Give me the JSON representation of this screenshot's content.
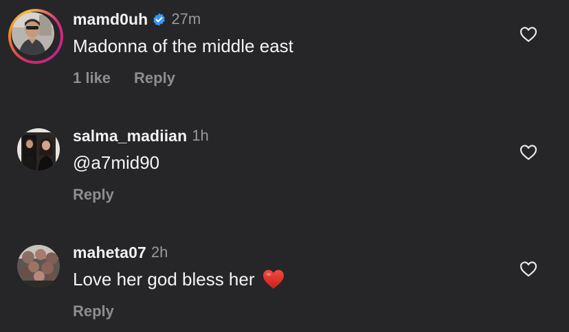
{
  "comments": [
    {
      "username": "mamd0uh",
      "verified": true,
      "has_story": true,
      "timestamp": "27m",
      "text": "Madonna of the middle east",
      "likes_label": "1 like",
      "reply_label": "Reply",
      "avatar_icon": "user-photo-avatar"
    },
    {
      "username": "salma_madiian",
      "verified": false,
      "has_story": false,
      "timestamp": "1h",
      "text": "@a7mid90",
      "reply_label": "Reply",
      "avatar_icon": "user-photo-avatar"
    },
    {
      "username": "maheta07",
      "verified": false,
      "has_story": false,
      "timestamp": "2h",
      "text": "Love her god bless her",
      "emoji": "red-heart-emoji",
      "reply_label": "Reply",
      "avatar_icon": "user-photo-avatar"
    }
  ],
  "colors": {
    "background": "#262628",
    "primary_text": "#f5f5f5",
    "secondary_text": "#8e8e90",
    "verified_blue": "#3897f0",
    "heart_red": "#e8302f"
  }
}
